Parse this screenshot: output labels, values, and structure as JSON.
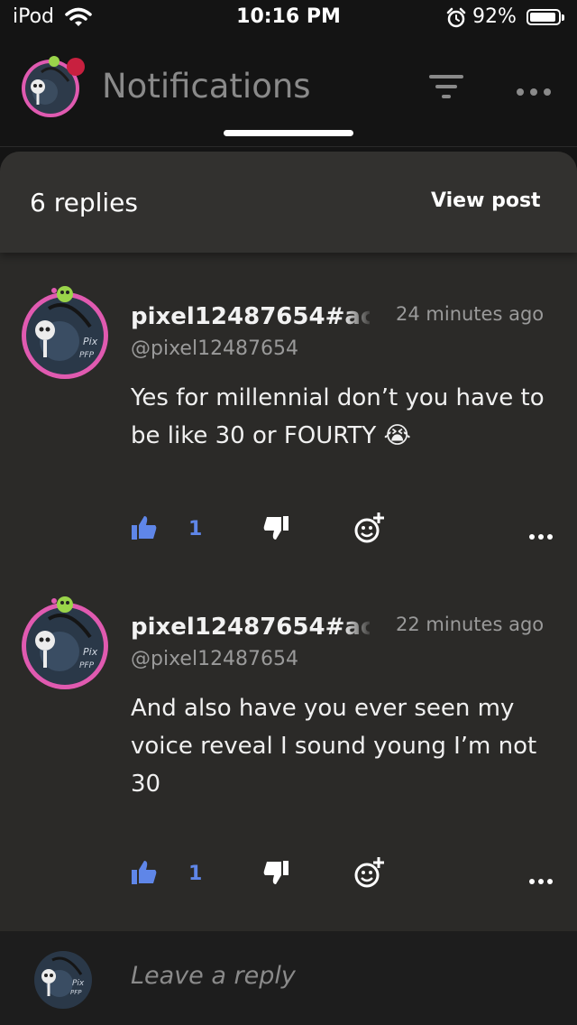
{
  "status_bar": {
    "carrier": "iPod",
    "time": "10:16 PM",
    "battery": "92%",
    "battery_level": 0.92
  },
  "header": {
    "title": "Notifications",
    "filter_icon": "filter-icon",
    "more_icon": "ellipsis-icon"
  },
  "thread": {
    "replies_count": "6 replies",
    "view_post": "View post"
  },
  "replies": [
    {
      "name": "pixel12487654#ac",
      "handle": "@pixel12487654",
      "time": "24 minutes ago",
      "text": "Yes for millennial don’t you have to be like 30 or FOURTY 😭",
      "likes": "1"
    },
    {
      "name": "pixel12487654#ac",
      "handle": "@pixel12487654",
      "time": "22 minutes ago",
      "text": "And also have you ever seen my voice reveal I sound young I’m not 30",
      "likes": "1"
    }
  ],
  "composer": {
    "placeholder": "Leave a reply"
  },
  "colors": {
    "accent": "#5f86e8",
    "avatar_ring": "#e05ab0"
  }
}
